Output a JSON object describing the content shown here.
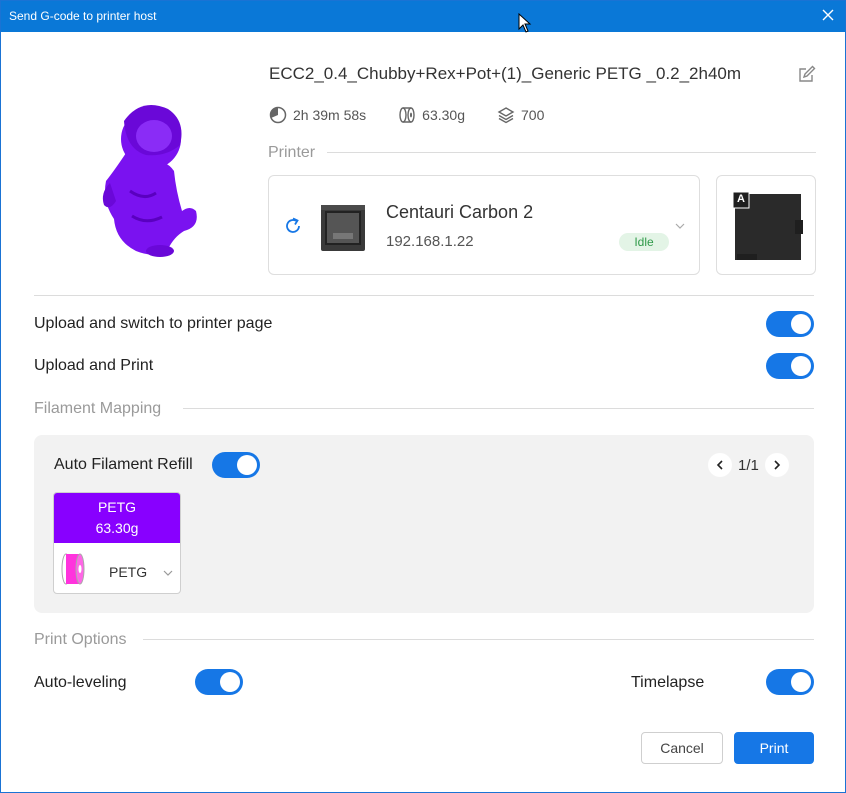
{
  "window": {
    "title": "Send G-code to printer host"
  },
  "file": {
    "name": "ECC2_0.4_Chubby+Rex+Pot+(1)_Generic PETG _0.2_2h40m",
    "time": "2h 39m 58s",
    "weight": "63.30g",
    "layers": "700",
    "thumbnail_color": "#7a12f0"
  },
  "printer_section": {
    "label": "Printer"
  },
  "printer": {
    "name": "Centauri Carbon 2",
    "ip": "192.168.1.22",
    "status": "Idle",
    "plate_label": "A"
  },
  "options": {
    "upload_switch": {
      "label": "Upload and switch to printer page",
      "on": true
    },
    "upload_print": {
      "label": "Upload and Print",
      "on": true
    }
  },
  "filament_section": {
    "label": "Filament Mapping"
  },
  "filament_mapping": {
    "auto_refill": {
      "label": "Auto Filament Refill",
      "on": true
    },
    "page": "1/1",
    "slots": [
      {
        "type": "PETG",
        "weight": "63.30g",
        "color": "#8800ff",
        "mapped": "PETG",
        "mapped_color": "#ff33dd"
      }
    ]
  },
  "print_options_section": {
    "label": "Print Options"
  },
  "print_options": {
    "auto_leveling": {
      "label": "Auto-leveling",
      "on": true
    },
    "timelapse": {
      "label": "Timelapse",
      "on": true
    }
  },
  "buttons": {
    "cancel": "Cancel",
    "print": "Print"
  },
  "colors": {
    "accent": "#1677e6",
    "titlebar": "#0a78d7",
    "idle": "#2f9a49"
  }
}
